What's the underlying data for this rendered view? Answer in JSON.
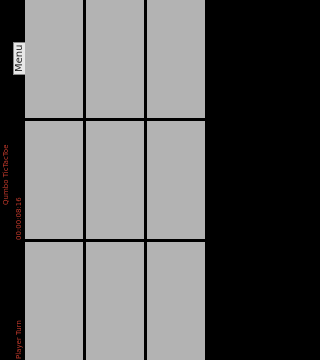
{
  "sidebar": {
    "menu_label": "Menu",
    "game_title": "Qumbo TicTacToe",
    "timer": "00:00:08:16",
    "turn_label": "Player Turn"
  },
  "board": {
    "rows": 3,
    "cols": 3,
    "cells": [
      "",
      "",
      "",
      "",
      "",
      "",
      "",
      "",
      ""
    ]
  },
  "colors": {
    "background": "#000000",
    "cell": "#b3b3b3",
    "accent_text": "#c0392b",
    "menu_button": "#e8e8e8"
  }
}
